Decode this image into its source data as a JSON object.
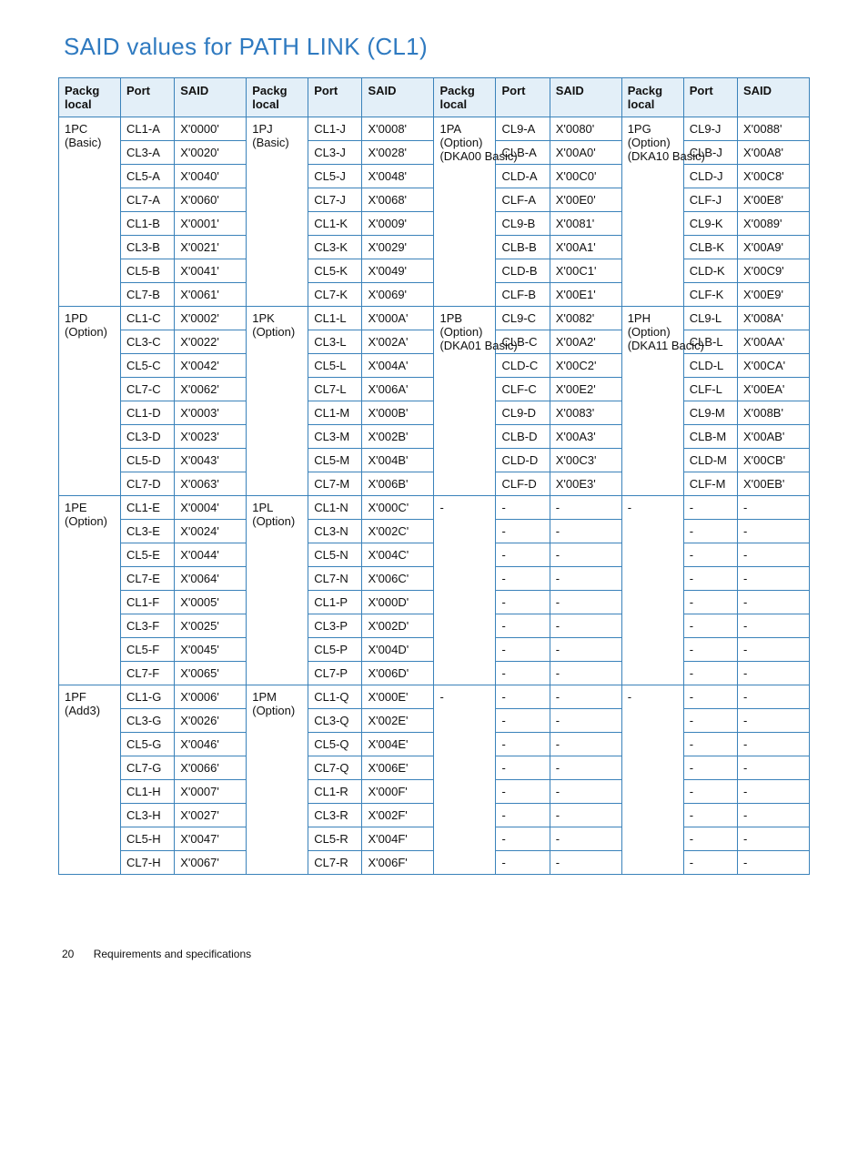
{
  "title": "SAID values for PATH LINK (CL1)",
  "headers": [
    "Packg local",
    "Port",
    "SAID",
    "Packg local",
    "Port",
    "SAID",
    "Packg local",
    "Port",
    "SAID",
    "Packg local",
    "Port",
    "SAID"
  ],
  "groups": [
    {
      "packg": [
        "1PC (Basic)",
        "1PJ (Basic)",
        "1PA (Option) (DKA00 Basic)",
        "1PG (Option) (DKA10 Basic)"
      ],
      "rows": [
        [
          "CL1-A",
          "X'0000'",
          "CL1-J",
          "X'0008'",
          "CL9-A",
          "X'0080'",
          "CL9-J",
          "X'0088'"
        ],
        [
          "CL3-A",
          "X'0020'",
          "CL3-J",
          "X'0028'",
          "CLB-A",
          "X'00A0'",
          "CLB-J",
          "X'00A8'"
        ],
        [
          "CL5-A",
          "X'0040'",
          "CL5-J",
          "X'0048'",
          "CLD-A",
          "X'00C0'",
          "CLD-J",
          "X'00C8'"
        ],
        [
          "CL7-A",
          "X'0060'",
          "CL7-J",
          "X'0068'",
          "CLF-A",
          "X'00E0'",
          "CLF-J",
          "X'00E8'"
        ],
        [
          "CL1-B",
          "X'0001'",
          "CL1-K",
          "X'0009'",
          "CL9-B",
          "X'0081'",
          "CL9-K",
          "X'0089'"
        ],
        [
          "CL3-B",
          "X'0021'",
          "CL3-K",
          "X'0029'",
          "CLB-B",
          "X'00A1'",
          "CLB-K",
          "X'00A9'"
        ],
        [
          "CL5-B",
          "X'0041'",
          "CL5-K",
          "X'0049'",
          "CLD-B",
          "X'00C1'",
          "CLD-K",
          "X'00C9'"
        ],
        [
          "CL7-B",
          "X'0061'",
          "CL7-K",
          "X'0069'",
          "CLF-B",
          "X'00E1'",
          "CLF-K",
          "X'00E9'"
        ]
      ]
    },
    {
      "packg": [
        "1PD (Option)",
        "1PK (Option)",
        "1PB (Option) (DKA01 Basic)",
        "1PH (Option) (DKA11 Bacic)"
      ],
      "rows": [
        [
          "CL1-C",
          "X'0002'",
          "CL1-L",
          "X'000A'",
          "CL9-C",
          "X'0082'",
          "CL9-L",
          "X'008A'"
        ],
        [
          "CL3-C",
          "X'0022'",
          "CL3-L",
          "X'002A'",
          "CLB-C",
          "X'00A2'",
          "CLB-L",
          "X'00AA'"
        ],
        [
          "CL5-C",
          "X'0042'",
          "CL5-L",
          "X'004A'",
          "CLD-C",
          "X'00C2'",
          "CLD-L",
          "X'00CA'"
        ],
        [
          "CL7-C",
          "X'0062'",
          "CL7-L",
          "X'006A'",
          "CLF-C",
          "X'00E2'",
          "CLF-L",
          "X'00EA'"
        ],
        [
          "CL1-D",
          "X'0003'",
          "CL1-M",
          "X'000B'",
          "CL9-D",
          "X'0083'",
          "CL9-M",
          "X'008B'"
        ],
        [
          "CL3-D",
          "X'0023'",
          "CL3-M",
          "X'002B'",
          "CLB-D",
          "X'00A3'",
          "CLB-M",
          "X'00AB'"
        ],
        [
          "CL5-D",
          "X'0043'",
          "CL5-M",
          "X'004B'",
          "CLD-D",
          "X'00C3'",
          "CLD-M",
          "X'00CB'"
        ],
        [
          "CL7-D",
          "X'0063'",
          "CL7-M",
          "X'006B'",
          "CLF-D",
          "X'00E3'",
          "CLF-M",
          "X'00EB'"
        ]
      ]
    },
    {
      "packg": [
        "1PE (Option)",
        "1PL (Option)",
        "-",
        "-"
      ],
      "rows": [
        [
          "CL1-E",
          "X'0004'",
          "CL1-N",
          "X'000C'",
          "-",
          "-",
          "-",
          "-"
        ],
        [
          "CL3-E",
          "X'0024'",
          "CL3-N",
          "X'002C'",
          "-",
          "-",
          "-",
          "-"
        ],
        [
          "CL5-E",
          "X'0044'",
          "CL5-N",
          "X'004C'",
          "-",
          "-",
          "-",
          "-"
        ],
        [
          "CL7-E",
          "X'0064'",
          "CL7-N",
          "X'006C'",
          "-",
          "-",
          "-",
          "-"
        ],
        [
          "CL1-F",
          "X'0005'",
          "CL1-P",
          "X'000D'",
          "-",
          "-",
          "-",
          "-"
        ],
        [
          "CL3-F",
          "X'0025'",
          "CL3-P",
          "X'002D'",
          "-",
          "-",
          "-",
          "-"
        ],
        [
          "CL5-F",
          "X'0045'",
          "CL5-P",
          "X'004D'",
          "-",
          "-",
          "-",
          "-"
        ],
        [
          "CL7-F",
          "X'0065'",
          "CL7-P",
          "X'006D'",
          "-",
          "-",
          "-",
          "-"
        ]
      ]
    },
    {
      "packg": [
        "1PF (Add3)",
        "1PM (Option)",
        "-",
        "-"
      ],
      "rows": [
        [
          "CL1-G",
          "X'0006'",
          "CL1-Q",
          "X'000E'",
          "-",
          "-",
          "-",
          "-"
        ],
        [
          "CL3-G",
          "X'0026'",
          "CL3-Q",
          "X'002E'",
          "-",
          "-",
          "-",
          "-"
        ],
        [
          "CL5-G",
          "X'0046'",
          "CL5-Q",
          "X'004E'",
          "-",
          "-",
          "-",
          "-"
        ],
        [
          "CL7-G",
          "X'0066'",
          "CL7-Q",
          "X'006E'",
          "-",
          "-",
          "-",
          "-"
        ],
        [
          "CL1-H",
          "X'0007'",
          "CL1-R",
          "X'000F'",
          "-",
          "-",
          "-",
          "-"
        ],
        [
          "CL3-H",
          "X'0027'",
          "CL3-R",
          "X'002F'",
          "-",
          "-",
          "-",
          "-"
        ],
        [
          "CL5-H",
          "X'0047'",
          "CL5-R",
          "X'004F'",
          "-",
          "-",
          "-",
          "-"
        ],
        [
          "CL7-H",
          "X'0067'",
          "CL7-R",
          "X'006F'",
          "-",
          "-",
          "-",
          "-"
        ]
      ]
    }
  ],
  "footer": {
    "page": "20",
    "section": "Requirements and specifications"
  }
}
